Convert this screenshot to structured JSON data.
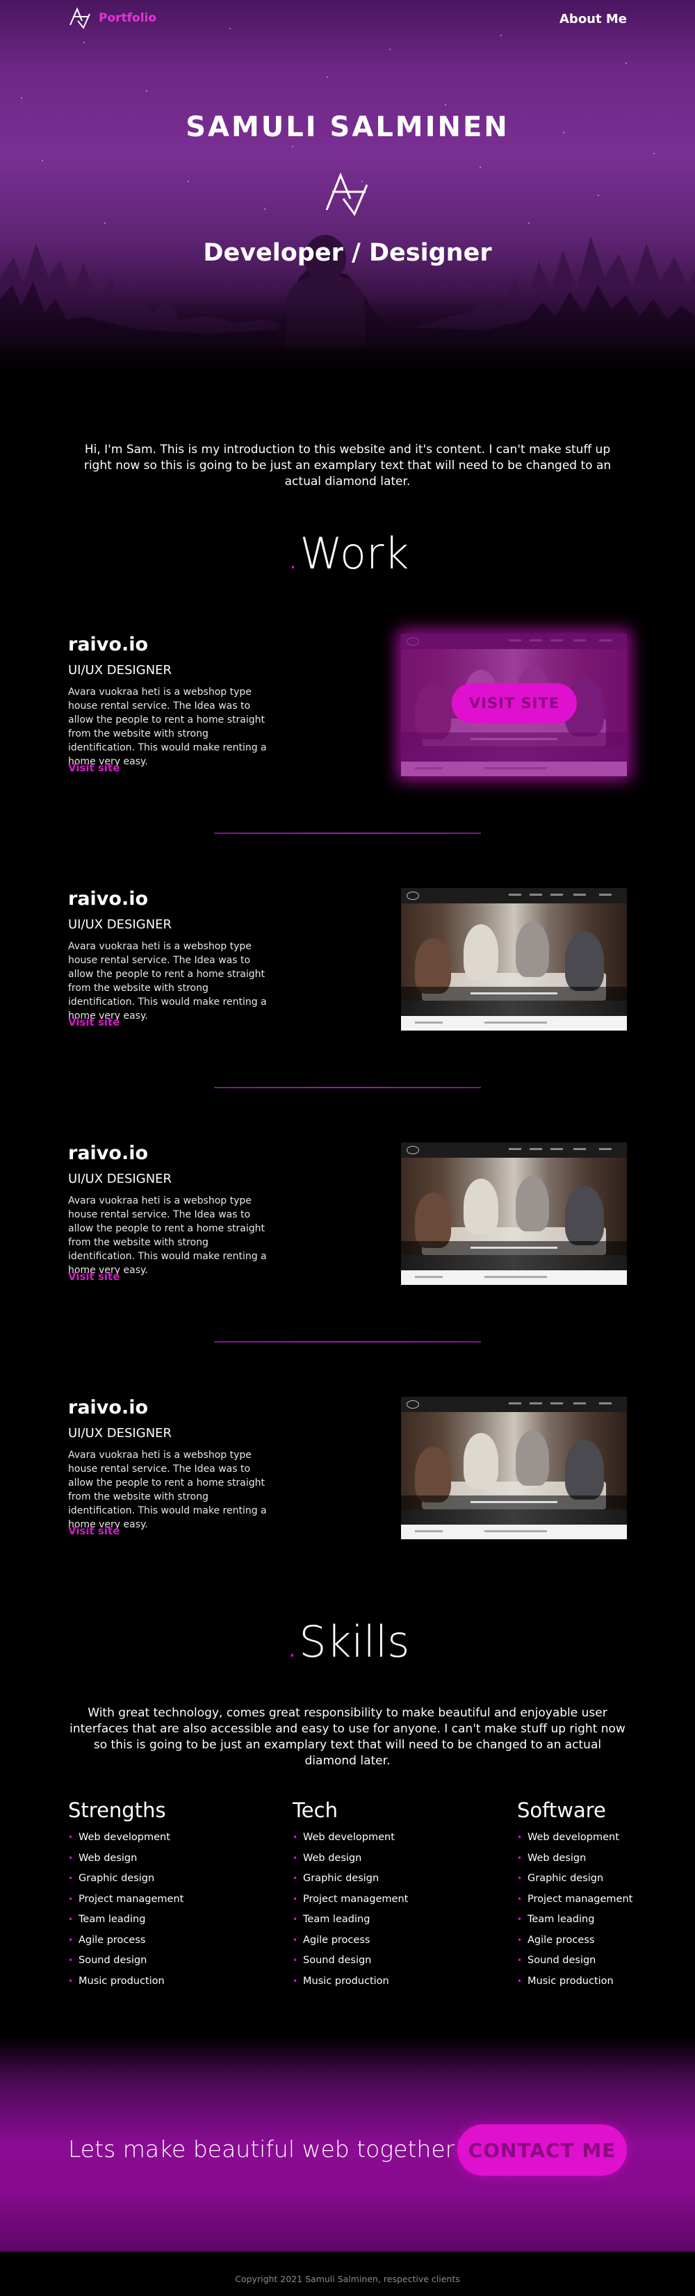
{
  "nav": {
    "logo_icon": "av-monogram-icon",
    "logo_text": "Portfolio",
    "about": "About Me"
  },
  "hero": {
    "name": "SAMULI SALMINEN",
    "mark_icon": "av-monogram-icon",
    "role": "Developer / Designer"
  },
  "intro": "Hi, I'm Sam. This is my introduction to this website and it's content. I can't make stuff up right now so this is going to be just an examplary text that will need to be changed to an actual diamond later.",
  "work": {
    "title_dot": ".",
    "title": "Work",
    "items": [
      {
        "title": "raivo.io",
        "role": "UI/UX DESIGNER",
        "description": "Avara vuokraa heti is a webshop type house rental service. The Idea was to allow the people to rent a home straight from the website with strong identification. This would make renting a home very easy.",
        "link": "Visit site",
        "hovered": true,
        "overlay_button": "VISIT SITE"
      },
      {
        "title": "raivo.io",
        "role": "UI/UX DESIGNER",
        "description": "Avara vuokraa heti is a webshop type house rental service. The Idea was to allow the people to rent a home straight from the website with strong identification. This would make renting a home very easy.",
        "link": "Visit site",
        "hovered": false
      },
      {
        "title": "raivo.io",
        "role": "UI/UX DESIGNER",
        "description": "Avara vuokraa heti is a webshop type house rental service. The Idea was to allow the people to rent a home straight from the website with strong identification. This would make renting a home very easy.",
        "link": "Visit site",
        "hovered": false
      },
      {
        "title": "raivo.io",
        "role": "UI/UX DESIGNER",
        "description": "Avara vuokraa heti is a webshop type house rental service. The Idea was to allow the people to rent a home straight from the website with strong identification. This would make renting a home very easy.",
        "link": "Visit site",
        "hovered": false
      }
    ]
  },
  "skills": {
    "title_dot": ".",
    "title": "Skills",
    "intro": "With great technology, comes great responsibility to make beautiful and enjoyable user interfaces that are also accessible and easy to use for anyone. I can't make stuff up right now so this is going to be just an examplary text that will need to be changed to an actual diamond later.",
    "bullet": "•",
    "columns": [
      {
        "heading": "Strengths",
        "items": [
          "Web development",
          "Web design",
          "Graphic design",
          "Project management",
          "Team leading",
          "Agile process",
          "Sound design",
          "Music production"
        ]
      },
      {
        "heading": "Tech",
        "items": [
          "Web development",
          "Web design",
          "Graphic design",
          "Project management",
          "Team leading",
          "Agile process",
          "Sound design",
          "Music production"
        ]
      },
      {
        "heading": "Software",
        "items": [
          "Web development",
          "Web design",
          "Graphic design",
          "Project management",
          "Team leading",
          "Agile process",
          "Sound design",
          "Music production"
        ]
      }
    ]
  },
  "cta": {
    "text": "Lets make beautiful web together!",
    "button": "CONTACT ME"
  },
  "footer": {
    "copyright": "Copyright 2021 Samuli Salminen, respective clients"
  },
  "colors": {
    "accent": "#e40ccb",
    "accent_dark": "#8a0a80",
    "link": "#d21bc4",
    "hero_purple": "#7a2f93",
    "cta_purple": "#8a0c93",
    "background": "#000000"
  }
}
